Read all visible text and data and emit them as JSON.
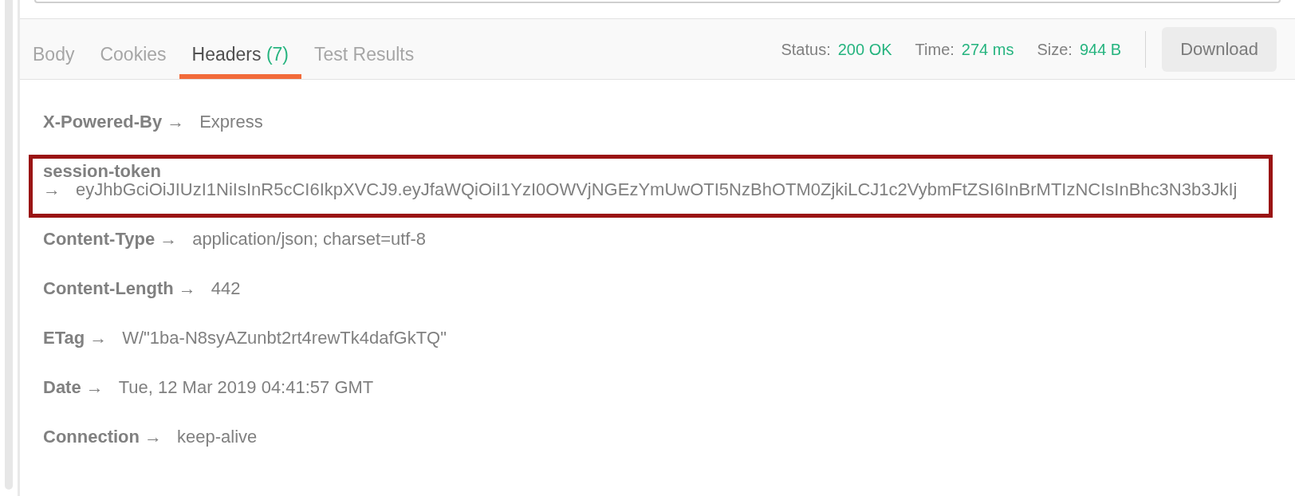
{
  "tabs": [
    {
      "label": "Body",
      "selected": false
    },
    {
      "label": "Cookies",
      "selected": false
    },
    {
      "label": "Headers",
      "count": "(7)",
      "selected": true
    },
    {
      "label": "Test Results",
      "selected": false
    }
  ],
  "response_meta": [
    {
      "label": "Status:",
      "value": "200 OK"
    },
    {
      "label": "Time:",
      "value": "274 ms"
    },
    {
      "label": "Size:",
      "value": "944 B"
    }
  ],
  "download_button": "Download",
  "headers": [
    {
      "key": "X-Powered-By",
      "arrow": "→",
      "value": "Express",
      "highlighted": false
    },
    {
      "key": "session-token",
      "arrow": "→",
      "value": "eyJhbGciOiJIUzI1NiIsInR5cCI6IkpXVCJ9.eyJfaWQiOiI1YzI0OWVjNGEzYmUwOTI5NzBhOTM0ZjkiLCJ1c2VybmFtZSI6InBrMTIzNCIsInBhc3N3b3JkIj",
      "highlighted": true
    },
    {
      "key": "Content-Type",
      "arrow": "→",
      "value": "application/json; charset=utf-8",
      "highlighted": false
    },
    {
      "key": "Content-Length",
      "arrow": "→",
      "value": "442",
      "highlighted": false
    },
    {
      "key": "ETag",
      "arrow": "→",
      "value": "W/\"1ba-N8syAZunbt2rt4rewTk4dafGkTQ\"",
      "highlighted": false
    },
    {
      "key": "Date",
      "arrow": "→",
      "value": "Tue, 12 Mar 2019 04:41:57 GMT",
      "highlighted": false
    },
    {
      "key": "Connection",
      "arrow": "→",
      "value": "keep-alive",
      "highlighted": false
    }
  ]
}
